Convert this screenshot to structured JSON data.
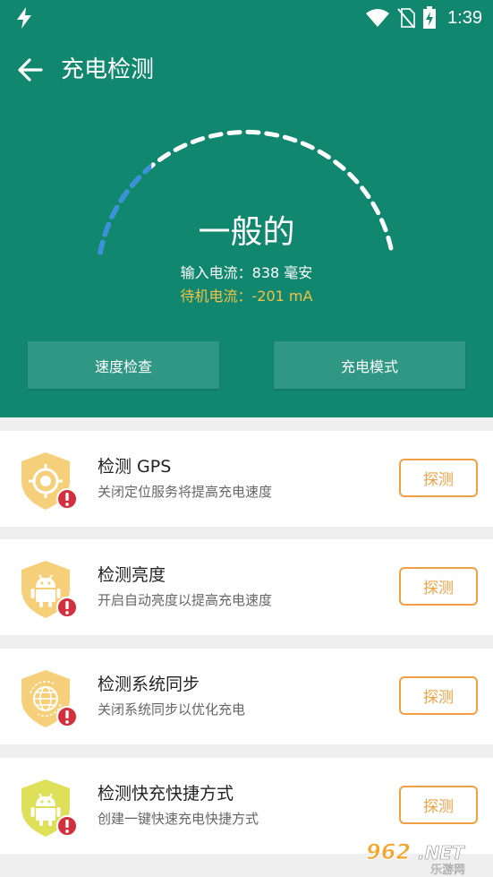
{
  "statusbar": {
    "time": "1:39",
    "icons": [
      "bolt-icon",
      "wifi-icon",
      "no-sim-icon",
      "battery-charging-icon"
    ]
  },
  "appbar": {
    "title": "充电检测",
    "back_icon": "arrow-left-icon"
  },
  "gauge": {
    "status": "一般的",
    "level_fraction": 0.25,
    "active_color": "#3a8fe0",
    "inactive_color": "#ffffff"
  },
  "readings": {
    "input_current": "输入电流：838 毫安",
    "standby_current": "待机电流：-201 mA",
    "standby_color": "#f0c24a"
  },
  "buttons": {
    "speed_check": "速度检查",
    "charge_mode": "充电模式"
  },
  "checks": [
    {
      "title": "检测 GPS",
      "desc": "关闭定位服务将提高充电速度",
      "action": "探测",
      "icon": "gps-target-icon"
    },
    {
      "title": "检测亮度",
      "desc": "开启自动亮度以提高充电速度",
      "action": "探测",
      "icon": "android-icon"
    },
    {
      "title": "检测系统同步",
      "desc": "关闭系统同步以优化充电",
      "action": "探测",
      "icon": "globe-sync-icon"
    },
    {
      "title": "检测快充快捷方式",
      "desc": "创建一键快速充电快捷方式",
      "action": "探测",
      "icon": "android-icon"
    }
  ],
  "watermark": {
    "text": "962.NET",
    "subtext": "乐游网"
  },
  "colors": {
    "header": "#12876f",
    "button": "#2f9783",
    "accent": "#f0a044",
    "shield": "#f6cf7a",
    "shield_lime": "#dfe05a",
    "alert": "#d32f3f"
  }
}
